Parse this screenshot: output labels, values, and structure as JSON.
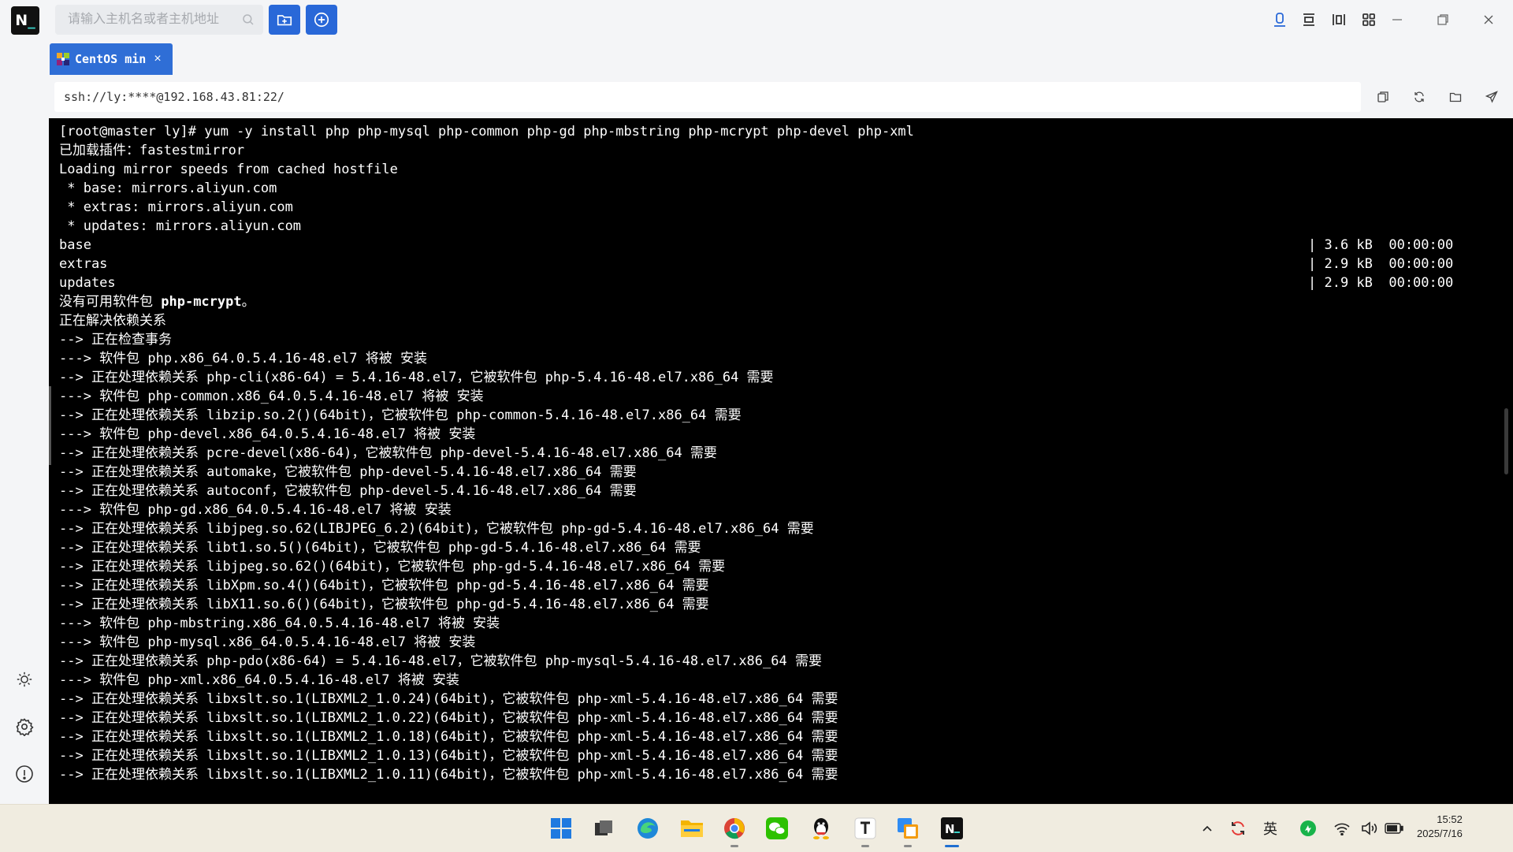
{
  "app": {
    "logo_text": "N",
    "logo_underscore": "_"
  },
  "search": {
    "placeholder": "请输入主机名或者主机地址"
  },
  "tab": {
    "label": "CentOS min",
    "close": "×"
  },
  "address": {
    "url": "ssh://ly:****@192.168.43.81:22/"
  },
  "terminal": {
    "lines": [
      {
        "t": "[root@master ly]# yum -y install php php-mysql php-common php-gd php-mbstring php-mcrypt php-devel php-xml"
      },
      {
        "t": "已加载插件：fastestmirror"
      },
      {
        "t": "Loading mirror speeds from cached hostfile"
      },
      {
        "t": " * base: mirrors.aliyun.com"
      },
      {
        "t": " * extras: mirrors.aliyun.com"
      },
      {
        "t": " * updates: mirrors.aliyun.com"
      },
      {
        "t": "base",
        "r": "| 3.6 kB  00:00:00"
      },
      {
        "t": "extras",
        "r": "| 2.9 kB  00:00:00"
      },
      {
        "t": "updates",
        "r": "| 2.9 kB  00:00:00"
      },
      {
        "t": "没有可用软件包 ",
        "b": "php-mcrypt",
        "a": "。"
      },
      {
        "t": "正在解决依赖关系"
      },
      {
        "t": "--> 正在检查事务"
      },
      {
        "t": "---> 软件包 php.x86_64.0.5.4.16-48.el7 将被 安装"
      },
      {
        "t": "--> 正在处理依赖关系 php-cli(x86-64) = 5.4.16-48.el7，它被软件包 php-5.4.16-48.el7.x86_64 需要"
      },
      {
        "t": "---> 软件包 php-common.x86_64.0.5.4.16-48.el7 将被 安装"
      },
      {
        "t": "--> 正在处理依赖关系 libzip.so.2()(64bit)，它被软件包 php-common-5.4.16-48.el7.x86_64 需要"
      },
      {
        "t": "---> 软件包 php-devel.x86_64.0.5.4.16-48.el7 将被 安装"
      },
      {
        "t": "--> 正在处理依赖关系 pcre-devel(x86-64)，它被软件包 php-devel-5.4.16-48.el7.x86_64 需要"
      },
      {
        "t": "--> 正在处理依赖关系 automake，它被软件包 php-devel-5.4.16-48.el7.x86_64 需要"
      },
      {
        "t": "--> 正在处理依赖关系 autoconf，它被软件包 php-devel-5.4.16-48.el7.x86_64 需要"
      },
      {
        "t": "---> 软件包 php-gd.x86_64.0.5.4.16-48.el7 将被 安装"
      },
      {
        "t": "--> 正在处理依赖关系 libjpeg.so.62(LIBJPEG_6.2)(64bit)，它被软件包 php-gd-5.4.16-48.el7.x86_64 需要"
      },
      {
        "t": "--> 正在处理依赖关系 libt1.so.5()(64bit)，它被软件包 php-gd-5.4.16-48.el7.x86_64 需要"
      },
      {
        "t": "--> 正在处理依赖关系 libjpeg.so.62()(64bit)，它被软件包 php-gd-5.4.16-48.el7.x86_64 需要"
      },
      {
        "t": "--> 正在处理依赖关系 libXpm.so.4()(64bit)，它被软件包 php-gd-5.4.16-48.el7.x86_64 需要"
      },
      {
        "t": "--> 正在处理依赖关系 libX11.so.6()(64bit)，它被软件包 php-gd-5.4.16-48.el7.x86_64 需要"
      },
      {
        "t": "---> 软件包 php-mbstring.x86_64.0.5.4.16-48.el7 将被 安装"
      },
      {
        "t": "---> 软件包 php-mysql.x86_64.0.5.4.16-48.el7 将被 安装"
      },
      {
        "t": "--> 正在处理依赖关系 php-pdo(x86-64) = 5.4.16-48.el7，它被软件包 php-mysql-5.4.16-48.el7.x86_64 需要"
      },
      {
        "t": "---> 软件包 php-xml.x86_64.0.5.4.16-48.el7 将被 安装"
      },
      {
        "t": "--> 正在处理依赖关系 libxslt.so.1(LIBXML2_1.0.24)(64bit)，它被软件包 php-xml-5.4.16-48.el7.x86_64 需要"
      },
      {
        "t": "--> 正在处理依赖关系 libxslt.so.1(LIBXML2_1.0.22)(64bit)，它被软件包 php-xml-5.4.16-48.el7.x86_64 需要"
      },
      {
        "t": "--> 正在处理依赖关系 libxslt.so.1(LIBXML2_1.0.18)(64bit)，它被软件包 php-xml-5.4.16-48.el7.x86_64 需要"
      },
      {
        "t": "--> 正在处理依赖关系 libxslt.so.1(LIBXML2_1.0.13)(64bit)，它被软件包 php-xml-5.4.16-48.el7.x86_64 需要"
      },
      {
        "t": "--> 正在处理依赖关系 libxslt.so.1(LIBXML2_1.0.11)(64bit)，它被软件包 php-xml-5.4.16-48.el7.x86_64 需要"
      }
    ]
  },
  "taskbar": {
    "tray": {
      "ime": "英",
      "time": "15:52",
      "date": "2025/7/16"
    }
  },
  "icons": {
    "search": "search-icon",
    "new_folder": "folder-plus-icon",
    "new_session": "plus-circle-icon",
    "theme": "sun-icon",
    "settings": "gear-icon",
    "about": "info-icon"
  },
  "colors": {
    "accent": "#2968d8",
    "tab": "#2f6ed6",
    "terminal_bg": "#000000",
    "terminal_fg": "#ffffff",
    "taskbar": "#f0ece0"
  }
}
